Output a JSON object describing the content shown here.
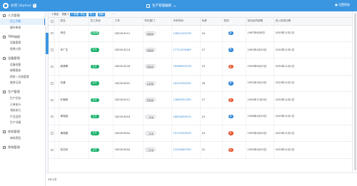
{
  "topbar": {
    "brand": "亦佳 (diymu)",
    "badge": "8",
    "tab_label": "生产管理编辑",
    "tab_close": "×",
    "user": "● 设置帮助"
  },
  "sidebar": {
    "groups": [
      {
        "label": "人力管理",
        "items": [
          {
            "label": "员工列表",
            "active": true
          },
          {
            "label": "操作审核",
            "active": false
          }
        ]
      },
      {
        "label": "TPM流程",
        "items": [
          {
            "label": "设备管理",
            "active": false
          },
          {
            "label": "保养计划",
            "active": false
          }
        ]
      },
      {
        "label": "设备管理",
        "items": [
          {
            "label": "设备档案",
            "active": false
          },
          {
            "label": "故障报修",
            "active": false
          },
          {
            "label": "检修 / 台账管理",
            "active": false
          },
          {
            "label": "维修记录",
            "active": false
          }
        ]
      },
      {
        "label": "生产管理",
        "items": [
          {
            "label": "生产任务",
            "active": false
          },
          {
            "label": "订单执行",
            "active": false
          },
          {
            "label": "领料执行",
            "active": false
          },
          {
            "label": "产品信息",
            "active": false
          },
          {
            "label": "生产详情",
            "active": false
          }
        ]
      },
      {
        "label": "质检管理",
        "items": [
          {
            "label": "来料检验",
            "active": false
          }
        ]
      },
      {
        "label": "系统管理",
        "items": []
      }
    ]
  },
  "toolbar": {
    "filter": "▾ 筛选",
    "views": "视图 ▾",
    "add": "+ 新增",
    "export": "导出",
    "import": "导入",
    "refresh": "刷新",
    "more": "···"
  },
  "table": {
    "columns": [
      "",
      "",
      "姓名",
      "员工状态",
      "工号",
      "所在部门",
      "手机号码",
      "年龄",
      "性别",
      "劳动合同到期",
      "进入系统日期"
    ],
    "rows": [
      {
        "name": "何佳",
        "status": "试用期",
        "id": "18226 8112",
        "dept": "组装部",
        "phone": "13621431978",
        "age": "24",
        "gender": "男",
        "gender_color": "#2f86d7",
        "contract": "1987年6月8日",
        "join": "2020年11月1日"
      },
      {
        "name": "许厂生",
        "status": "正式",
        "id": "18226 8124",
        "dept": "组装部",
        "phone": "17712478489",
        "age": "27",
        "gender": "男",
        "gender_color": "#2f86d7",
        "contract": "1981年4月23日",
        "join": "2020年11月1日"
      },
      {
        "name": "廖倩倩",
        "status": "正式",
        "id": "18226 8126",
        "dept": "组装部",
        "phone": "18968902278",
        "age": "23",
        "gender": "女",
        "gender_color": "#e8572f",
        "contract": "1990年6月20日",
        "join": "2020年11月1日"
      },
      {
        "name": "刘建",
        "status": "正式",
        "id": "18226 8001",
        "dept": "后勤部",
        "phone": "18221832035",
        "age": "28",
        "gender": "男",
        "gender_color": "#2f86d7",
        "contract": "1991年3月10日",
        "join": "2020年11月1日"
      },
      {
        "name": "叶梅苑",
        "status": "正式",
        "id": "18226 8112",
        "dept": "质检部",
        "phone": "13682951289",
        "age": "27",
        "gender": "女",
        "gender_color": "#e8572f",
        "contract": "1990年12月5日",
        "join": "2020年11月1日"
      },
      {
        "name": "章晓强",
        "status": "正式",
        "id": "18226 8016",
        "dept": "一车间",
        "phone": "18831805074",
        "age": "23",
        "gender": "男",
        "gender_color": "#2f86d7",
        "contract": "1998年4月23日",
        "join": "2020年11月1日"
      },
      {
        "name": "黄丽霞",
        "status": "正式",
        "id": "18226 8004",
        "dept": "二车间",
        "phone": "15172009526",
        "age": "24",
        "gender": "女",
        "gender_color": "#e8572f",
        "contract": "1995年4月23日",
        "join": "2020年11月1日"
      },
      {
        "name": "张芯欣",
        "status": "正式",
        "id": "18226 8004",
        "dept": "三车间",
        "phone": "13316481905",
        "age": "22",
        "gender": "女",
        "gender_color": "#e8572f",
        "contract": "1990年4月23日",
        "join": "2020年11月1日"
      }
    ]
  },
  "bottombar": {
    "text": "8条记录"
  }
}
